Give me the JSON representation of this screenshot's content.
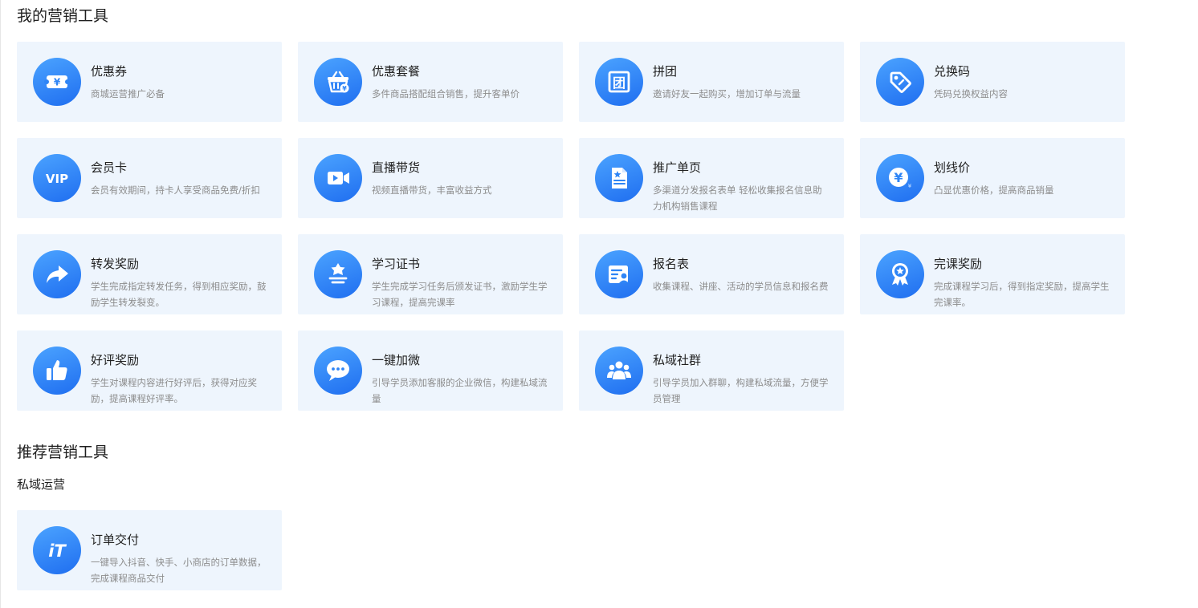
{
  "my_tools": {
    "heading": "我的营销工具",
    "cards": [
      {
        "title": "优惠券",
        "desc": "商城运营推广必备",
        "icon": "coupon-icon"
      },
      {
        "title": "优惠套餐",
        "desc": "多件商品搭配组合销售，提升客单价",
        "icon": "basket-icon"
      },
      {
        "title": "拼团",
        "desc": "邀请好友一起购买，增加订单与流量",
        "icon": "group-buy-icon"
      },
      {
        "title": "兑换码",
        "desc": "凭码兑换权益内容",
        "icon": "tag-icon"
      },
      {
        "title": "会员卡",
        "desc": "会员有效期间，持卡人享受商品免费/折扣",
        "icon": "vip-icon"
      },
      {
        "title": "直播带货",
        "desc": "视频直播带货，丰富收益方式",
        "icon": "video-camera-icon"
      },
      {
        "title": "推广单页",
        "desc": "多渠道分发报名表单 轻松收集报名信息助力机构销售课程",
        "icon": "document-star-icon"
      },
      {
        "title": "划线价",
        "desc": "凸显优惠价格，提高商品销量",
        "icon": "yen-coin-icon"
      },
      {
        "title": "转发奖励",
        "desc": "学生完成指定转发任务，得到相应奖励，鼓励学生转发裂变。",
        "icon": "share-arrow-icon"
      },
      {
        "title": "学习证书",
        "desc": "学生完成学习任务后颁发证书，激励学生学习课程，提高完课率",
        "icon": "certificate-icon"
      },
      {
        "title": "报名表",
        "desc": "收集课程、讲座、活动的学员信息和报名费",
        "icon": "form-user-icon"
      },
      {
        "title": "完课奖励",
        "desc": "完成课程学习后，得到指定奖励，提高学生完课率。",
        "icon": "medal-icon"
      },
      {
        "title": "好评奖励",
        "desc": "学生对课程内容进行好评后，获得对应奖励，提高课程好评率。",
        "icon": "thumbs-up-icon"
      },
      {
        "title": "一键加微",
        "desc": "引导学员添加客服的企业微信，构建私域流量",
        "icon": "chat-bubble-icon"
      },
      {
        "title": "私域社群",
        "desc": "引导学员加入群聊，构建私域流量，方便学员管理",
        "icon": "community-icon"
      }
    ]
  },
  "recommended": {
    "heading": "推荐营销工具",
    "subheading": "私域运营",
    "cards": [
      {
        "title": "订单交付",
        "desc": "一键导入抖音、快手、小商店的订单数据，完成课程商品交付",
        "icon": "order-icon"
      }
    ]
  },
  "colors": {
    "card_bg": "#eef5fd",
    "icon_gradient_start": "#4ba3ff",
    "icon_gradient_end": "#1f6ef0"
  }
}
